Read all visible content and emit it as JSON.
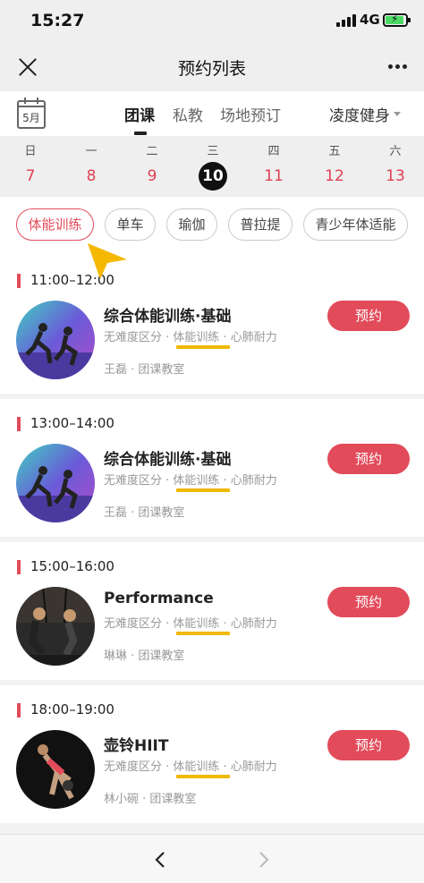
{
  "status": {
    "time": "15:27",
    "network": "4G"
  },
  "nav": {
    "title": "预约列表"
  },
  "calendar": {
    "month_label": "5月"
  },
  "tabs": [
    {
      "label": "团课",
      "active": true
    },
    {
      "label": "私教",
      "active": false
    },
    {
      "label": "场地预订",
      "active": false
    }
  ],
  "gym": {
    "label": "凌度健身"
  },
  "week": [
    {
      "day": "日",
      "date": "7"
    },
    {
      "day": "一",
      "date": "8"
    },
    {
      "day": "二",
      "date": "9"
    },
    {
      "day": "三",
      "date": "10",
      "selected": true
    },
    {
      "day": "四",
      "date": "11"
    },
    {
      "day": "五",
      "date": "12"
    },
    {
      "day": "六",
      "date": "13"
    }
  ],
  "chips": [
    {
      "label": "体能训练",
      "active": true
    },
    {
      "label": "单车"
    },
    {
      "label": "瑜伽"
    },
    {
      "label": "普拉提"
    },
    {
      "label": "青少年体适能"
    }
  ],
  "colors": {
    "accent": "#e24b5a",
    "highlight": "#f0b800",
    "date_red": "#e04050"
  },
  "classes": [
    {
      "time": "11:00–12:00",
      "name": "综合体能训练·基础",
      "tags": "无难度区分 · 体能训练 · 心肺耐力",
      "coach": "王磊 · 团课教室",
      "book_label": "预约",
      "image": "group-training-photo"
    },
    {
      "time": "13:00–14:00",
      "name": "综合体能训练·基础",
      "tags": "无难度区分 · 体能训练 · 心肺耐力",
      "coach": "王磊 · 团课教室",
      "book_label": "预约",
      "image": "group-training-photo"
    },
    {
      "time": "15:00–16:00",
      "name": "Performance",
      "tags": "无难度区分 · 体能训练 · 心肺耐力",
      "coach": "琳琳 · 团课教室",
      "book_label": "预约",
      "image": "trx-training-photo"
    },
    {
      "time": "18:00–19:00",
      "name": "壶铃HIIT",
      "tags": "无难度区分 · 体能训练 · 心肺耐力",
      "coach": "林小碗 · 团课教室",
      "book_label": "预约",
      "image": "kettlebell-photo"
    }
  ]
}
